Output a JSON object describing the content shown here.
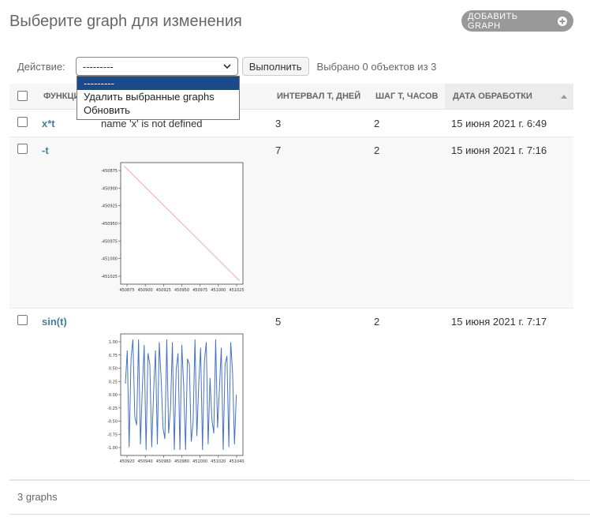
{
  "page": {
    "title": "Выберите graph для изменения",
    "add_button": "ДОБАВИТЬ GRAPH"
  },
  "actions": {
    "label": "Действие:",
    "selected": "---------",
    "options": [
      "---------",
      "Удалить выбранные graphs",
      "Обновить"
    ],
    "go_button": "Выполнить",
    "counter": "Выбрано 0 объектов из 3"
  },
  "table": {
    "headers": {
      "function": "ФУНКЦИ",
      "interval": "ИНТЕРВАЛ T, ДНЕЙ",
      "step": "ШАГ T, ЧАСОВ",
      "date": "ДАТА ОБРАБОТКИ"
    },
    "rows": [
      {
        "function": "x*t",
        "graph_error": "name 'x' is not defined",
        "interval": "3",
        "step": "2",
        "date": "15 июня 2021 г. 6:49"
      },
      {
        "function": "-t",
        "interval": "7",
        "step": "2",
        "date": "15 июня 2021 г. 7:16"
      },
      {
        "function": "sin(t)",
        "interval": "5",
        "step": "2",
        "date": "15 июня 2021 г. 7:17"
      }
    ]
  },
  "charts": {
    "neg_t": {
      "yticks": [
        "-450875",
        "-450900",
        "-450925",
        "-450950",
        "-450975",
        "-451000",
        "-451025"
      ],
      "xticks": [
        "450875",
        "450900",
        "450925",
        "450950",
        "450975",
        "451000",
        "451025"
      ]
    },
    "sin_t": {
      "yticks": [
        "1.00",
        "0.75",
        "0.50",
        "0.25",
        "0.00",
        "-0.25",
        "-0.50",
        "-0.75",
        "-1.00"
      ],
      "xticks": [
        "450920",
        "450940",
        "450960",
        "450980",
        "451000",
        "451020",
        "451040"
      ]
    }
  },
  "chart_data": [
    {
      "type": "line",
      "x": [
        450865,
        451035
      ],
      "series": [
        {
          "values": [
            -450865,
            -451035
          ]
        }
      ],
      "xlim": [
        450860,
        451040
      ],
      "ylim": [
        -451040,
        -450860
      ],
      "color": "#f4a6b8"
    },
    {
      "type": "line",
      "x": [
        450920,
        450922,
        450924,
        450926,
        450928,
        450930,
        450932,
        450934,
        450936,
        450938,
        450940,
        450942,
        450944,
        450946,
        450948,
        450950,
        450952,
        450954,
        450956,
        450958,
        450960,
        450962,
        450964,
        450966,
        450968,
        450970,
        450972,
        450974,
        450976,
        450978,
        450980,
        450982,
        450984,
        450986,
        450988,
        450990,
        450992,
        450994,
        450996,
        450998,
        451000,
        451002,
        451004,
        451006,
        451008,
        451010,
        451012,
        451014,
        451016,
        451018,
        451020,
        451022,
        451024,
        451026,
        451028,
        451030,
        451032,
        451034,
        451036,
        451038
      ],
      "series": [
        {
          "values": [
            0.2,
            0.8,
            -0.95,
            0.65,
            1.0,
            -0.4,
            -0.55,
            1.0,
            -0.9,
            0.1,
            0.9,
            -1.0,
            0.75,
            0.55,
            -0.95,
            0.05,
            0.8,
            -0.9,
            0.95,
            0.3,
            -0.6,
            -0.8,
            1.0,
            -0.7,
            -0.25,
            0.95,
            -1.0,
            0.45,
            0.75,
            -1.0,
            0.9,
            0.15,
            -1.0,
            0.65,
            0.55,
            -0.85,
            -0.5,
            1.0,
            -0.75,
            0.2,
            0.85,
            -1.0,
            0.6,
            0.95,
            -0.9,
            0.3,
            -0.45,
            -0.7,
            1.0,
            -0.6,
            0.1,
            0.85,
            -1.0,
            0.55,
            0.7,
            -0.95,
            0.95,
            0.4,
            -0.9,
            0.0
          ]
        }
      ],
      "xlim": [
        450915,
        451045
      ],
      "ylim": [
        -1.1,
        1.1
      ],
      "color": "#4472c4"
    }
  ]
}
